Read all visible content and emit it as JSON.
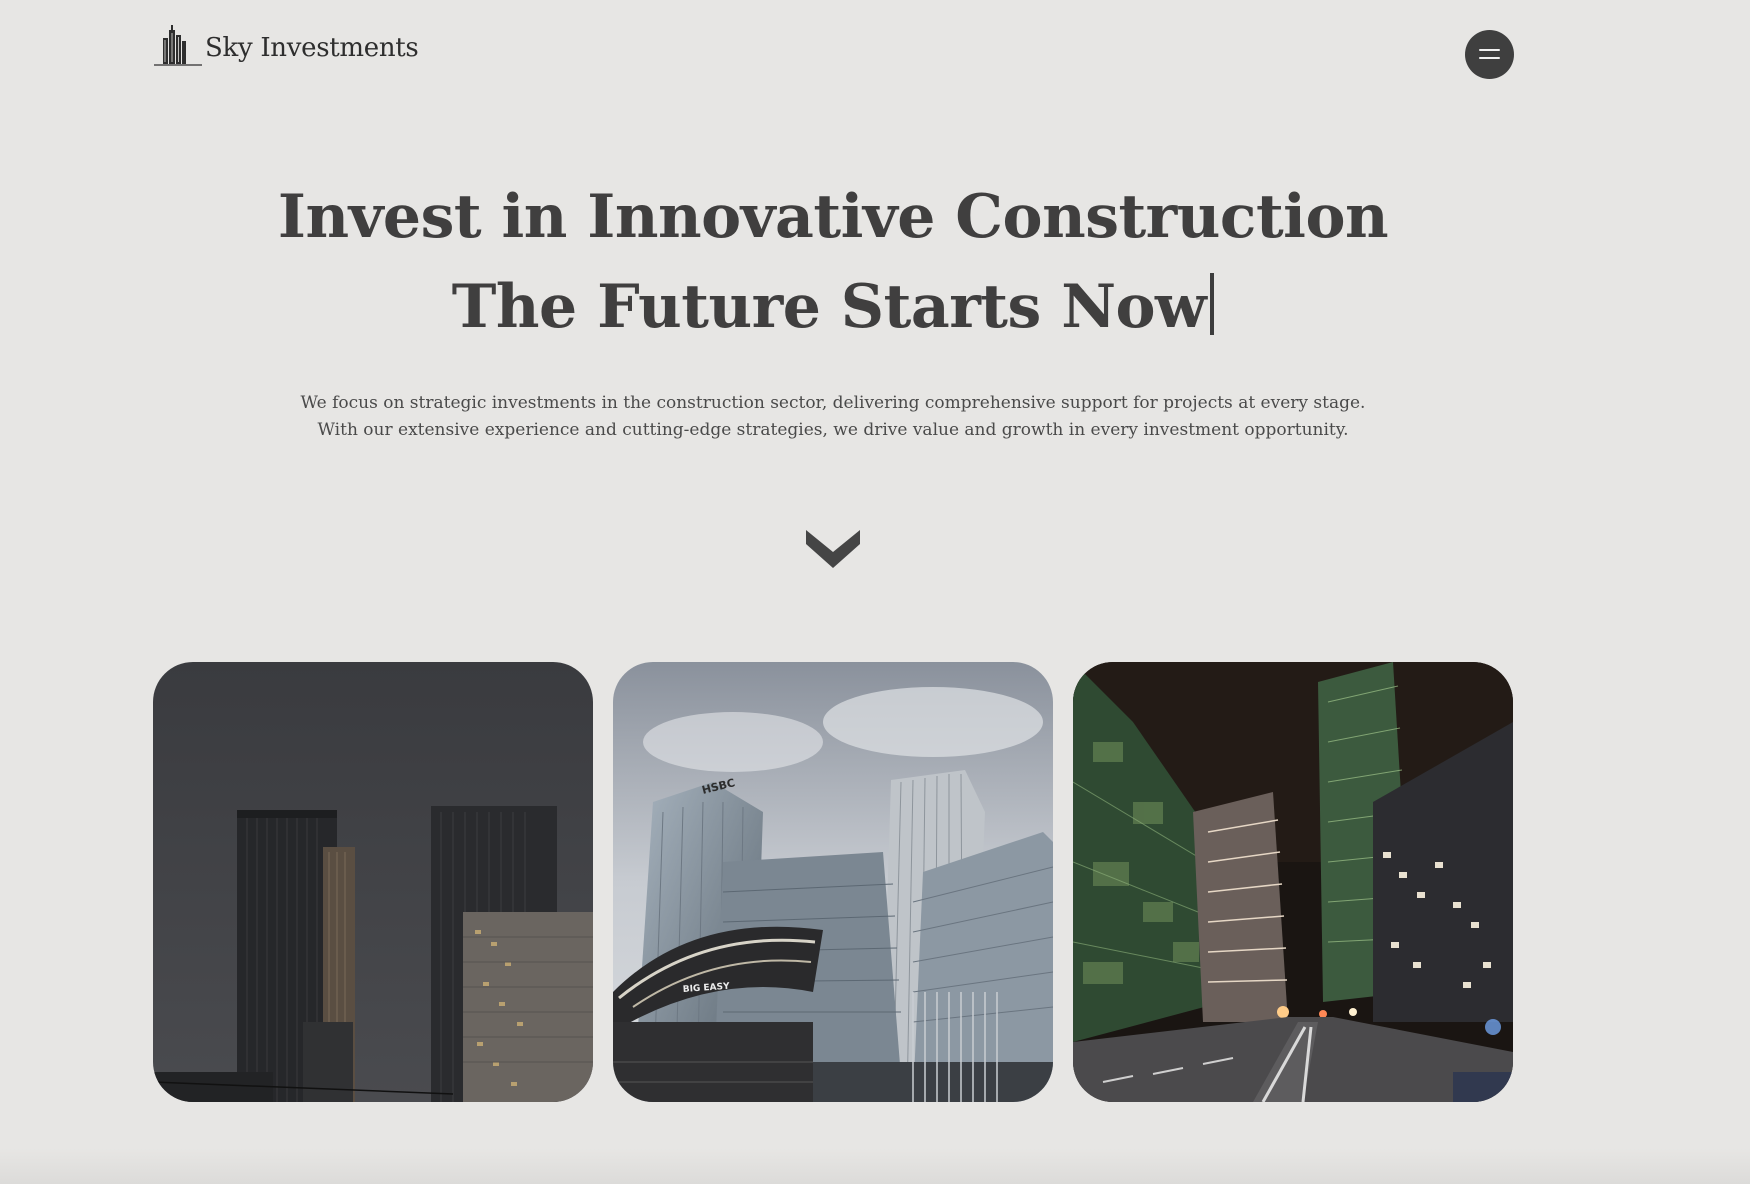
{
  "header": {
    "logo_text": "Sky Investments",
    "logo_icon": "skyline-icon",
    "menu_icon": "hamburger-menu-icon"
  },
  "hero": {
    "title_line1": "Invest in Innovative Construction",
    "title_line2": "The Future Starts Now",
    "description": "We focus on strategic investments in the construction sector, delivering comprehensive support for projects at every stage. With our extensive experience and cutting-edge strategies, we drive value and growth in every investment opportunity.",
    "scroll_icon": "chevron-down-icon"
  },
  "gallery": {
    "images": [
      {
        "subject": "dark skyscrapers at dusk"
      },
      {
        "subject": "glass office towers and station canopy",
        "sign_text": "HSBC",
        "canopy_text": "BIG EASY"
      },
      {
        "subject": "illuminated city street at night"
      }
    ]
  },
  "colors": {
    "background": "#e7e6e4",
    "text": "#403f3f",
    "menu_button": "#3f3f3f"
  }
}
